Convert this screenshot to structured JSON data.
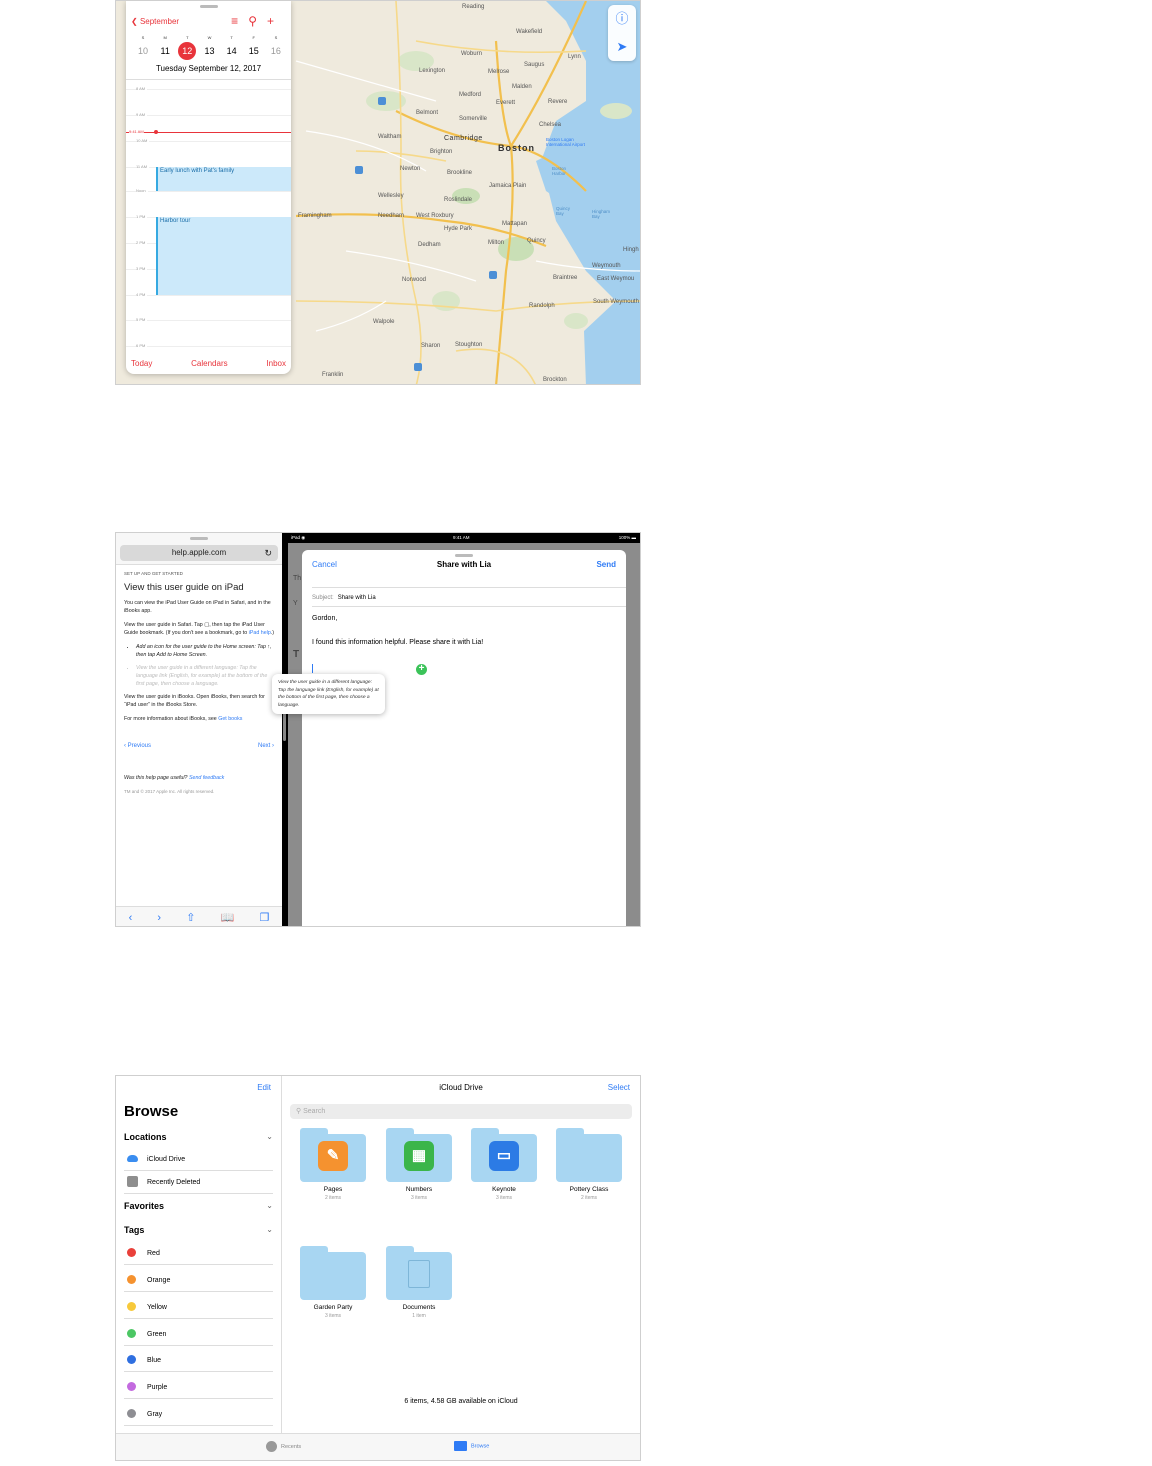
{
  "screen1": {
    "map_labels": {
      "reading": "Reading",
      "wakefield": "Wakefield",
      "lynn": "Lynn",
      "woburn": "Woburn",
      "saugus": "Saugus",
      "lexington": "Lexington",
      "melrose": "Melrose",
      "malden": "Malden",
      "medford": "Medford",
      "everett": "Everett",
      "revere": "Revere",
      "belmont": "Belmont",
      "somerville": "Somerville",
      "chelsea": "Chelsea",
      "waltham": "Waltham",
      "cambridge": "Cambridge",
      "boston": "Boston",
      "brighton": "Brighton",
      "logan": "Boston Logan International Airport",
      "newton": "Newton",
      "brookline": "Brookline",
      "boston_harbor": "Boston Harbor",
      "wellesley": "Wellesley",
      "jamaica_plain": "Jamaica Plain",
      "roslindale": "Roslindale",
      "framingham": "Framingham",
      "needham": "Needham",
      "west_roxbury": "West Roxbury",
      "quincy_bay": "Quincy Bay",
      "hingham_bay": "Hingham Bay",
      "mattapan": "Mattapan",
      "hyde_park": "Hyde Park",
      "dedham": "Dedham",
      "milton": "Milton",
      "quincy": "Quincy",
      "weymouth": "Weymouth",
      "hingham": "Hingh",
      "norwood": "Norwood",
      "braintree": "Braintree",
      "east_weymouth": "East Weymou",
      "randolph": "Randolph",
      "south_weymouth": "South Weymouth",
      "walpole": "Walpole",
      "sharon": "Sharon",
      "stoughton": "Stoughton",
      "franklin": "Franklin",
      "brockton": "Brockton"
    },
    "calendar": {
      "back_label": "September",
      "weekdays": [
        "S",
        "M",
        "T",
        "W",
        "T",
        "F",
        "S"
      ],
      "days": [
        "10",
        "11",
        "12",
        "13",
        "14",
        "15",
        "16"
      ],
      "date_full": "Tuesday  September 12, 2017",
      "hours": [
        "8 AM",
        "9 AM",
        "10 AM",
        "11 AM",
        "Noon",
        "1 PM",
        "2 PM",
        "3 PM",
        "4 PM",
        "5 PM",
        "6 PM"
      ],
      "now": "9:41 AM",
      "events": [
        "Early lunch with Pat's family",
        "Harbor tour"
      ],
      "footer": {
        "today": "Today",
        "calendars": "Calendars",
        "inbox": "Inbox"
      }
    }
  },
  "screen2": {
    "url": "help.apple.com",
    "kicker": "SET UP AND GET STARTED",
    "heading": "View this user guide on iPad",
    "intro": "You can view the iPad User Guide on iPad in Safari, and in the iBooks app.",
    "safari_para": "View the user guide in Safari. Tap ▢, then tap the iPad User Guide bookmark. (If you don't see a bookmark, go to ",
    "ipad_help": "iPad help",
    "safari_para_end": ".)",
    "bullet1": "Add an icon for the user guide to the Home screen: Tap ↑, then tap Add to Home Screen.",
    "bullet2": "View the user guide in a different language: Tap the language link (English, for example) at the bottom of the first page, then choose a language.",
    "ibooks_para": "View the user guide in iBooks. Open iBooks, then search for “iPad user” in the iBooks Store.",
    "more_info": "For more information about iBooks, see ",
    "get_books": "Get books",
    "previous": "‹  Previous",
    "next": "Next  ›",
    "feedback_q": "Was this help page useful? ",
    "feedback_link": "Send feedback",
    "copyright": "TM and © 2017 Apple Inc. All rights reserved.",
    "status": {
      "carrier": "iPad ◉",
      "time": "9:41 AM",
      "battery": "100% ▬"
    },
    "mail": {
      "cancel": "Cancel",
      "title": "Share with Lia",
      "send": "Send",
      "subject_label": "Subject:",
      "subject_value": "Share with Lia",
      "greeting": "Gordon,",
      "body": "I found this information helpful. Please share it with Lia!",
      "dropped": "View the user guide in a different language: Tap the language link (English, for example) at the bottom of the first page, then choose a language."
    }
  },
  "screen3": {
    "edit": "Edit",
    "browse": "Browse",
    "locations": "Locations",
    "icloud": "iCloud Drive",
    "recently_deleted": "Recently Deleted",
    "favorites": "Favorites",
    "tags_title": "Tags",
    "tags": [
      {
        "name": "Red",
        "color": "#e9403a"
      },
      {
        "name": "Orange",
        "color": "#f5922f"
      },
      {
        "name": "Yellow",
        "color": "#f7c93b"
      },
      {
        "name": "Green",
        "color": "#4cc764"
      },
      {
        "name": "Blue",
        "color": "#2f6fe0"
      },
      {
        "name": "Purple",
        "color": "#c36adf"
      },
      {
        "name": "Gray",
        "color": "#8e8e93"
      }
    ],
    "title": "iCloud Drive",
    "select": "Select",
    "search_placeholder": "Search",
    "folders": [
      {
        "name": "Pages",
        "count": "2 items",
        "icon": "pages-app-icon",
        "color": "#f5922f"
      },
      {
        "name": "Numbers",
        "count": "3 items",
        "icon": "numbers-app-icon",
        "color": "#3bb54a"
      },
      {
        "name": "Keynote",
        "count": "3 items",
        "icon": "keynote-app-icon",
        "color": "#2c7be5"
      },
      {
        "name": "Pottery Class",
        "count": "2 items"
      },
      {
        "name": "Garden Party",
        "count": "3 items"
      },
      {
        "name": "Documents",
        "count": "1 item",
        "icon": "document-icon"
      }
    ],
    "status": "6 items, 4.58 GB available on iCloud",
    "tab_recents": "Recents",
    "tab_browse": "Browse"
  }
}
